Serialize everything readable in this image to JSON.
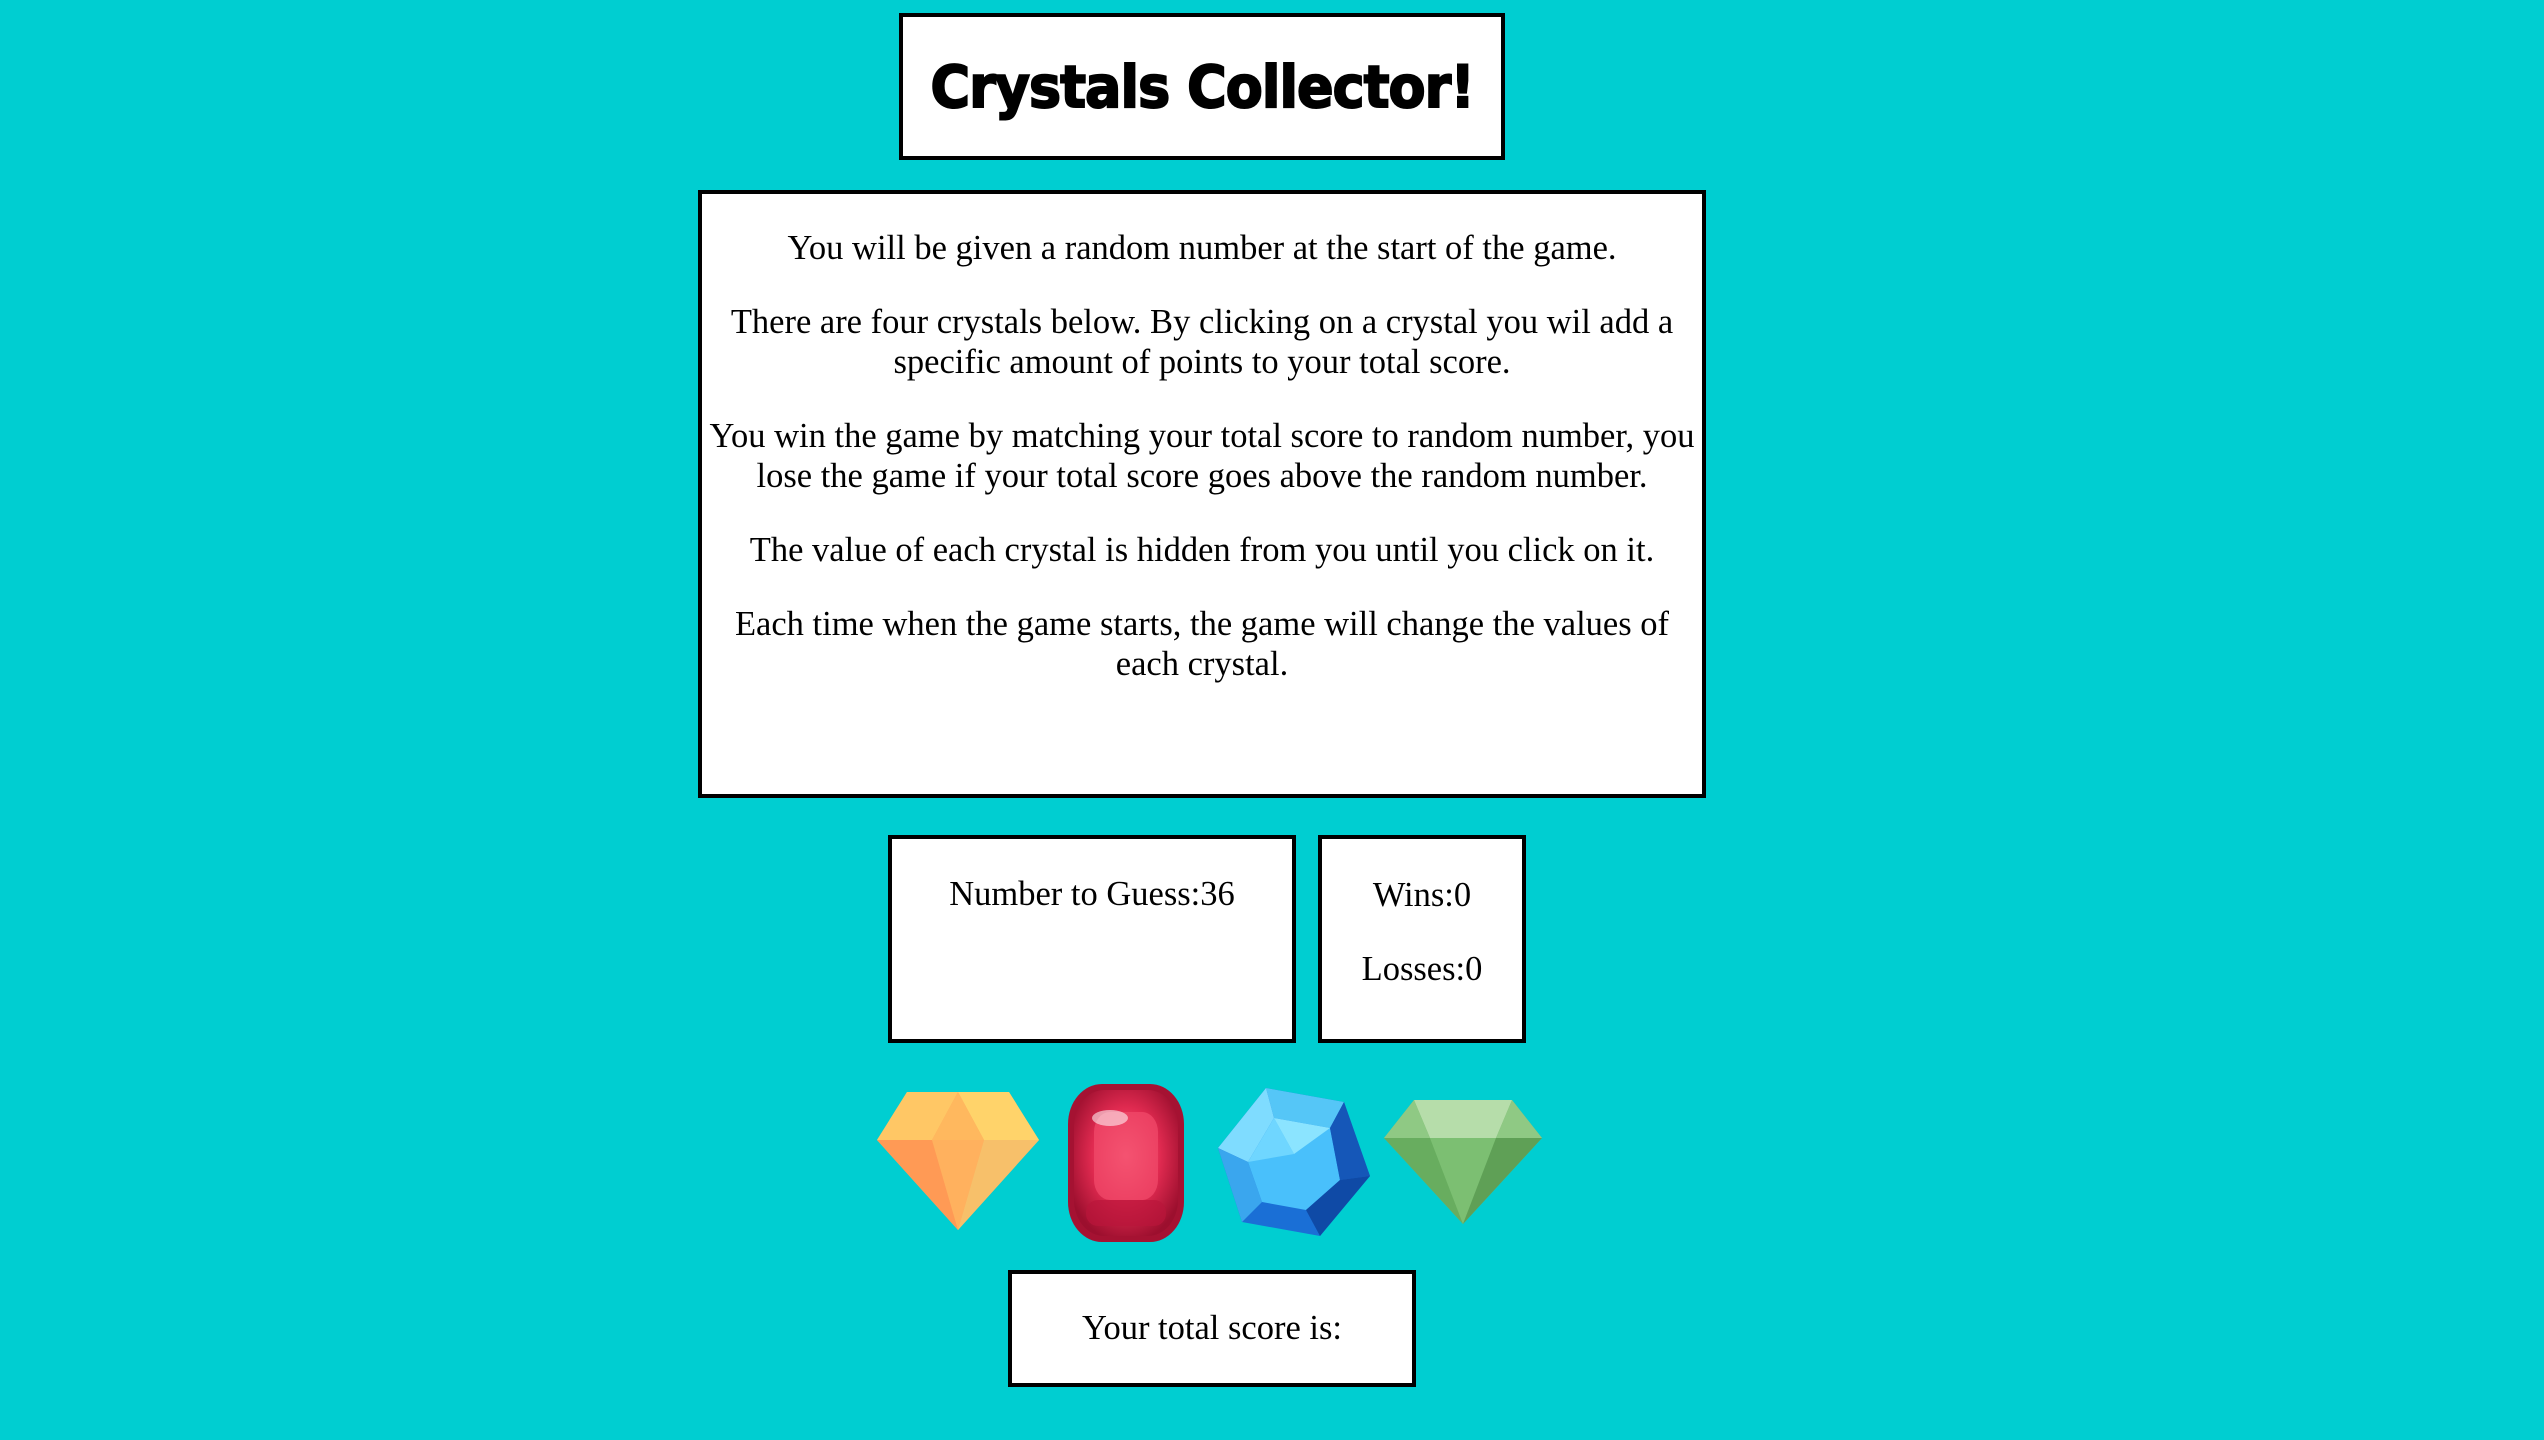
{
  "title": "Crystals Collector!",
  "instructions": [
    "You will be given a random number at the start of the game.",
    "There are four crystals below. By clicking on a crystal you wil add a specific amount of points to your total score.",
    "You win the game by matching your total score to random number, you lose the game if your total score goes above the random number.",
    "The value of each crystal is hidden from you until you click on it.",
    "Each time when the game starts, the game will change the values of each crystal."
  ],
  "guess": {
    "label": "Number to Guess:",
    "value": "36"
  },
  "stats": {
    "wins_label": "Wins:",
    "wins": "0",
    "losses_label": "Losses:",
    "losses": "0"
  },
  "score": {
    "label": "Your total score is:",
    "value": ""
  },
  "crystals": [
    {
      "name": "orange-diamond-crystal",
      "color": "#ffa95a"
    },
    {
      "name": "red-ruby-crystal",
      "color": "#d6204a"
    },
    {
      "name": "blue-sapphire-crystal",
      "color": "#2aa8f0"
    },
    {
      "name": "green-emerald-crystal",
      "color": "#7cbf72"
    }
  ]
}
